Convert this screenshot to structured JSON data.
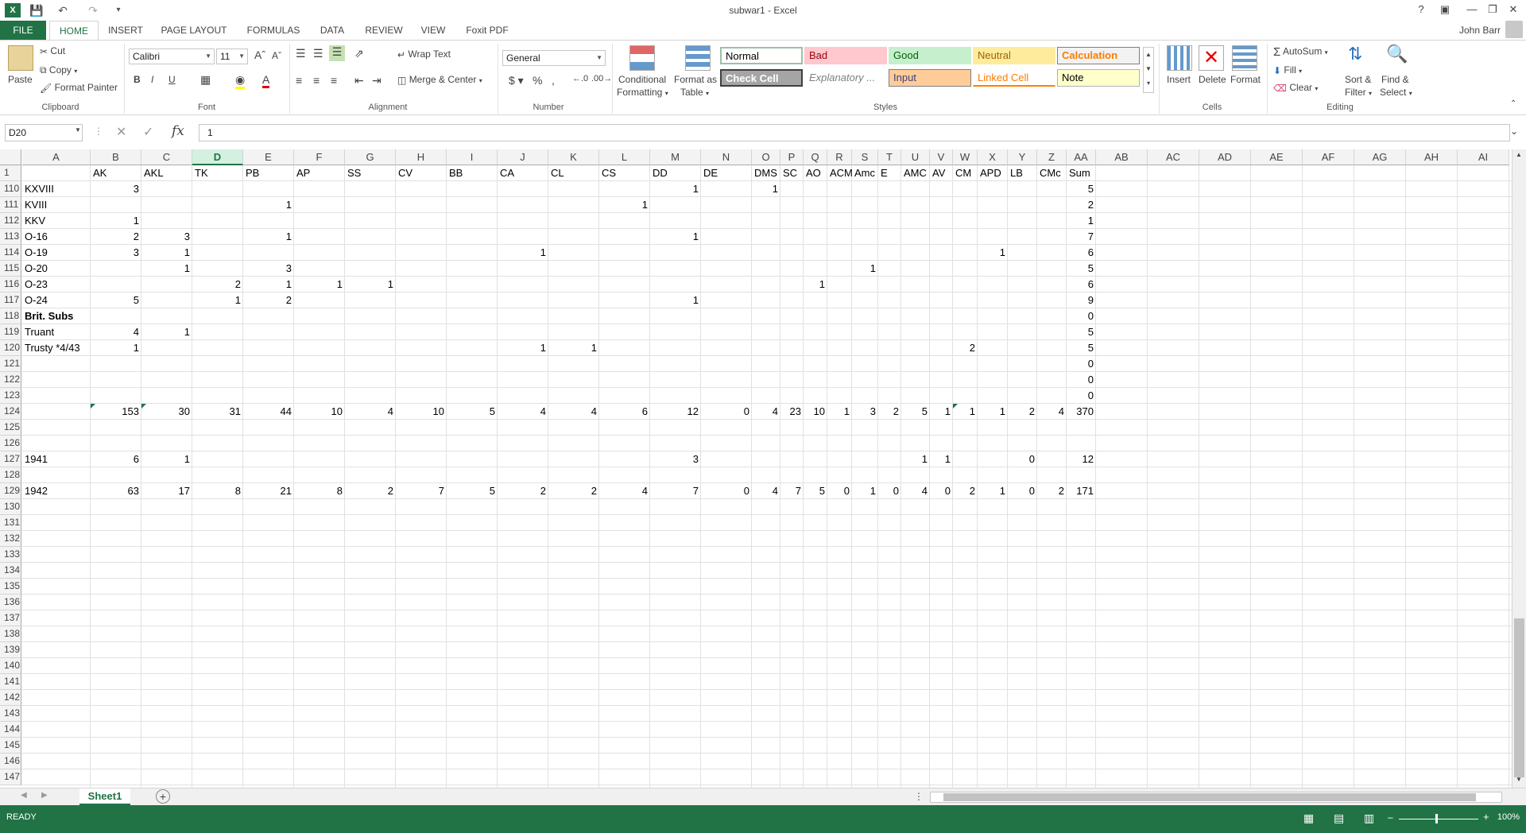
{
  "window": {
    "title": "subwar1 - Excel",
    "user": "John Barr"
  },
  "tabs": [
    "FILE",
    "HOME",
    "INSERT",
    "PAGE LAYOUT",
    "FORMULAS",
    "DATA",
    "REVIEW",
    "VIEW",
    "Foxit PDF"
  ],
  "ribbon": {
    "clipboard": {
      "paste": "Paste",
      "cut": "Cut",
      "copy": "Copy",
      "format_painter": "Format Painter",
      "label": "Clipboard"
    },
    "font": {
      "name": "Calibri",
      "size": "11",
      "label": "Font"
    },
    "alignment": {
      "wrap": "Wrap Text",
      "merge": "Merge & Center",
      "label": "Alignment"
    },
    "number": {
      "format": "General",
      "label": "Number"
    },
    "styles": {
      "conditional": "Conditional",
      "conditional2": "Formatting",
      "format_as": "Format as",
      "format_as2": "Table",
      "normal": "Normal",
      "bad": "Bad",
      "good": "Good",
      "neutral": "Neutral",
      "calculation": "Calculation",
      "check": "Check Cell",
      "explanatory": "Explanatory ...",
      "input": "Input",
      "linked": "Linked Cell",
      "note": "Note",
      "label": "Styles"
    },
    "cells": {
      "insert": "Insert",
      "delete": "Delete",
      "format": "Format",
      "label": "Cells"
    },
    "editing": {
      "autosum": "AutoSum",
      "fill": "Fill",
      "clear": "Clear",
      "sort": "Sort &",
      "sort2": "Filter",
      "find": "Find &",
      "find2": "Select",
      "label": "Editing"
    },
    "colors": {
      "accent": "#217346"
    }
  },
  "formula_bar": {
    "name_box": "D20",
    "formula": "1"
  },
  "columns": [
    "A",
    "B",
    "C",
    "D",
    "E",
    "F",
    "G",
    "H",
    "I",
    "J",
    "K",
    "L",
    "M",
    "N",
    "O",
    "P",
    "Q",
    "R",
    "S",
    "T",
    "U",
    "V",
    "W",
    "X",
    "Y",
    "Z",
    "AA",
    "AB",
    "AC",
    "AD",
    "AE",
    "AF",
    "AG",
    "AH",
    "AI"
  ],
  "header_row": {
    "num": "1",
    "cells": [
      "",
      "AK",
      "AKL",
      "TK",
      "PB",
      "AP",
      "SS",
      "CV",
      "BB",
      "CA",
      "CL",
      "CS",
      "DD",
      "DE",
      "DMS",
      "SC",
      "AO",
      "ACM",
      "Amc",
      "E",
      "AMC",
      "AV",
      "CM",
      "APD",
      "LB",
      "CMc",
      "Sum"
    ]
  },
  "rows": [
    {
      "num": "110",
      "a": "KXVIII",
      "v": {
        "B": "3",
        "M": "1",
        "O": "1",
        "AA": "5"
      }
    },
    {
      "num": "111",
      "a": "KVIII",
      "v": {
        "E": "1",
        "L": "1",
        "AA": "2"
      }
    },
    {
      "num": "112",
      "a": "KKV",
      "v": {
        "B": "1",
        "AA": "1"
      }
    },
    {
      "num": "113",
      "a": "O-16",
      "v": {
        "B": "2",
        "C": "3",
        "E": "1",
        "M": "1",
        "AA": "7"
      }
    },
    {
      "num": "114",
      "a": "O-19",
      "v": {
        "B": "3",
        "C": "1",
        "J": "1",
        "X": "1",
        "AA": "6"
      }
    },
    {
      "num": "115",
      "a": "O-20",
      "v": {
        "C": "1",
        "E": "3",
        "S": "1",
        "AA": "5"
      }
    },
    {
      "num": "116",
      "a": "O-23",
      "v": {
        "D": "2",
        "E": "1",
        "F": "1",
        "G": "1",
        "Q": "1",
        "AA": "6"
      }
    },
    {
      "num": "117",
      "a": "O-24",
      "v": {
        "B": "5",
        "D": "1",
        "E": "2",
        "M": "1",
        "AA": "9"
      }
    },
    {
      "num": "118",
      "a": "Brit. Subs",
      "bold": true,
      "v": {
        "AA": "0"
      }
    },
    {
      "num": "119",
      "a": "Truant",
      "v": {
        "B": "4",
        "C": "1",
        "AA": "5"
      }
    },
    {
      "num": "120",
      "a": "Trusty *4/43",
      "v": {
        "B": "1",
        "J": "1",
        "K": "1",
        "W": "2",
        "AA": "5"
      }
    },
    {
      "num": "121",
      "a": "",
      "v": {
        "AA": "0"
      }
    },
    {
      "num": "122",
      "a": "",
      "v": {
        "AA": "0"
      }
    },
    {
      "num": "123",
      "a": "",
      "v": {
        "AA": "0"
      }
    },
    {
      "num": "124",
      "a": "",
      "v": {
        "B": "153",
        "C": "30",
        "D": "31",
        "E": "44",
        "F": "10",
        "G": "4",
        "H": "10",
        "I": "5",
        "J": "4",
        "K": "4",
        "L": "6",
        "M": "12",
        "N": "0",
        "O": "4",
        "P": "23",
        "Q": "10",
        "R": "1",
        "S": "3",
        "T": "2",
        "U": "5",
        "V": "1",
        "W": "1",
        "X": "1",
        "Y": "2",
        "Z": "4",
        "AA": "370"
      }
    },
    {
      "num": "125",
      "a": "",
      "v": {}
    },
    {
      "num": "126",
      "a": "",
      "v": {}
    },
    {
      "num": "127",
      "a": "1941",
      "v": {
        "B": "6",
        "C": "1",
        "M": "3",
        "U": "1",
        "V": "1",
        "Y": "0",
        "AA": "12"
      }
    },
    {
      "num": "128",
      "a": "",
      "v": {}
    },
    {
      "num": "129",
      "a": "1942",
      "v": {
        "B": "63",
        "C": "17",
        "D": "8",
        "E": "21",
        "F": "8",
        "G": "2",
        "H": "7",
        "I": "5",
        "J": "2",
        "K": "2",
        "L": "4",
        "M": "7",
        "N": "0",
        "O": "4",
        "P": "7",
        "Q": "5",
        "R": "0",
        "S": "1",
        "T": "0",
        "U": "4",
        "V": "0",
        "W": "2",
        "X": "1",
        "Y": "0",
        "Z": "2",
        "AA": "171"
      }
    },
    {
      "num": "130",
      "a": "",
      "v": {}
    },
    {
      "num": "131",
      "a": "",
      "v": {}
    },
    {
      "num": "132",
      "a": "",
      "v": {}
    },
    {
      "num": "133",
      "a": "",
      "v": {}
    },
    {
      "num": "134",
      "a": "",
      "v": {}
    },
    {
      "num": "135",
      "a": "",
      "v": {}
    },
    {
      "num": "136",
      "a": "",
      "v": {}
    },
    {
      "num": "137",
      "a": "",
      "v": {}
    },
    {
      "num": "138",
      "a": "",
      "v": {}
    },
    {
      "num": "139",
      "a": "",
      "v": {}
    },
    {
      "num": "140",
      "a": "",
      "v": {}
    },
    {
      "num": "141",
      "a": "",
      "v": {}
    },
    {
      "num": "142",
      "a": "",
      "v": {}
    },
    {
      "num": "143",
      "a": "",
      "v": {}
    },
    {
      "num": "144",
      "a": "",
      "v": {}
    },
    {
      "num": "145",
      "a": "",
      "v": {}
    },
    {
      "num": "146",
      "a": "",
      "v": {}
    },
    {
      "num": "147",
      "a": "",
      "v": {}
    }
  ],
  "sheet_tabs": [
    "Sheet1"
  ],
  "status": {
    "ready": "READY",
    "zoom": "100%"
  }
}
